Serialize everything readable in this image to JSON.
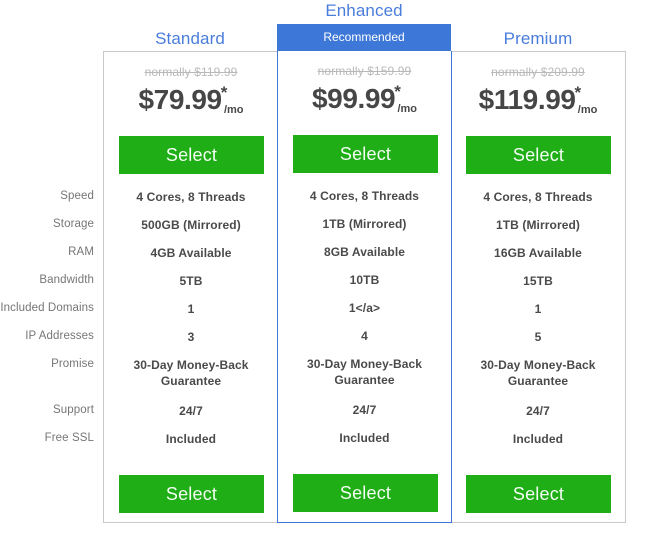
{
  "ribbon": {
    "label": "Recommended"
  },
  "row_labels": [
    "Speed",
    "Storage",
    "RAM",
    "Bandwidth",
    "Included Domains",
    "IP Addresses",
    "Promise",
    "Support",
    "Free SSL"
  ],
  "colors": {
    "plan_name": "#4a7ddb",
    "ribbon_bg": "#3d78d8",
    "select_button": "#1fae16",
    "select_button_text": "#f4fdf4",
    "card_border": "#c9c9c9",
    "highlight_border": "#3d78d8",
    "price_text": "#464646",
    "strike_text": "#b9b9b9",
    "label_text": "#767676",
    "feature_text": "#4a4a4a"
  },
  "plans": [
    {
      "name": "Standard",
      "normally": "normally $119.99",
      "price": "$79.99",
      "price_star": "*",
      "price_period": "/mo",
      "select_top_label": "Select",
      "select_bottom_label": "Select",
      "features": [
        "4 Cores, 8 Threads",
        "500GB (Mirrored)",
        "4GB Available",
        "5TB",
        "1",
        "3",
        "30-Day Money-Back Guarantee",
        "24/7",
        "Included"
      ]
    },
    {
      "name": "Enhanced",
      "normally": "normally $159.99",
      "price": "$99.99",
      "price_star": "*",
      "price_period": "/mo",
      "select_top_label": "Select",
      "select_bottom_label": "Select",
      "features": [
        "4 Cores, 8 Threads",
        "1TB (Mirrored)",
        "8GB Available",
        "10TB",
        "1</a>",
        "4",
        "30-Day Money-Back Guarantee",
        "24/7",
        "Included"
      ]
    },
    {
      "name": "Premium",
      "normally": "normally $209.99",
      "price": "$119.99",
      "price_star": "*",
      "price_period": "/mo",
      "select_top_label": "Select",
      "select_bottom_label": "Select",
      "features": [
        "4 Cores, 8 Threads",
        "1TB (Mirrored)",
        "16GB Available",
        "15TB",
        "1",
        "5",
        "30-Day Money-Back Guarantee",
        "24/7",
        "Included"
      ]
    }
  ]
}
